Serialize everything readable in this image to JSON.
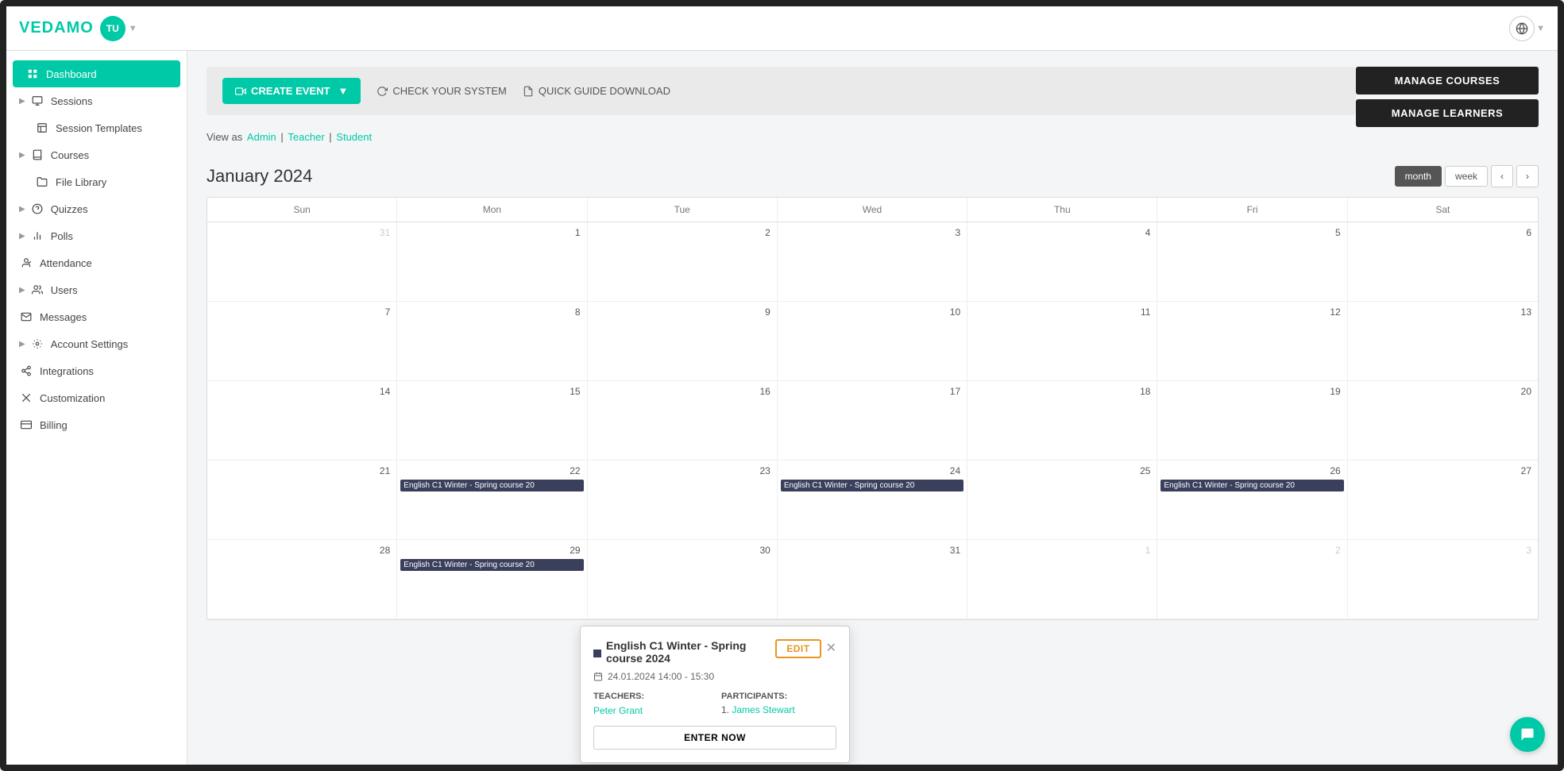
{
  "app": {
    "logo": "VEDAMO",
    "avatar": "TU",
    "title": "Dashboard"
  },
  "sidebar": {
    "items": [
      {
        "id": "dashboard",
        "label": "Dashboard",
        "icon": "grid",
        "active": true,
        "hasArrow": false
      },
      {
        "id": "sessions",
        "label": "Sessions",
        "icon": "video",
        "active": false,
        "hasArrow": true
      },
      {
        "id": "session-templates",
        "label": "Session Templates",
        "icon": "layout",
        "active": false,
        "hasArrow": false
      },
      {
        "id": "courses",
        "label": "Courses",
        "icon": "book",
        "active": false,
        "hasArrow": true
      },
      {
        "id": "file-library",
        "label": "File Library",
        "icon": "folder",
        "active": false,
        "hasArrow": false
      },
      {
        "id": "quizzes",
        "label": "Quizzes",
        "icon": "help-circle",
        "active": false,
        "hasArrow": true
      },
      {
        "id": "polls",
        "label": "Polls",
        "icon": "bar-chart",
        "active": false,
        "hasArrow": true
      },
      {
        "id": "attendance",
        "label": "Attendance",
        "icon": "user-check",
        "active": false,
        "hasArrow": false
      },
      {
        "id": "users",
        "label": "Users",
        "icon": "users",
        "active": false,
        "hasArrow": true
      },
      {
        "id": "messages",
        "label": "Messages",
        "icon": "mail",
        "active": false,
        "hasArrow": false
      },
      {
        "id": "account-settings",
        "label": "Account Settings",
        "icon": "settings",
        "active": false,
        "hasArrow": true
      },
      {
        "id": "integrations",
        "label": "Integrations",
        "icon": "link",
        "active": false,
        "hasArrow": false
      },
      {
        "id": "customization",
        "label": "Customization",
        "icon": "scissors",
        "active": false,
        "hasArrow": false
      },
      {
        "id": "billing",
        "label": "Billing",
        "icon": "credit-card",
        "active": false,
        "hasArrow": false
      }
    ]
  },
  "toolbar": {
    "create_event_label": "CREATE EVENT",
    "check_system_label": "CHECK YOUR SYSTEM",
    "quick_guide_label": "QUICK GUIDE DOWNLOAD"
  },
  "right_actions": {
    "manage_courses_label": "MANAGE COURSES",
    "manage_learners_label": "MANAGE LEARNERS"
  },
  "view_as": {
    "label": "View as",
    "admin": "Admin",
    "teacher": "Teacher",
    "student": "Student"
  },
  "calendar": {
    "title": "January 2024",
    "view_month": "month",
    "view_week": "week",
    "days": [
      "Sun",
      "Mon",
      "Tue",
      "Wed",
      "Thu",
      "Fri",
      "Sat"
    ],
    "cells": [
      {
        "num": "31",
        "other": true,
        "events": []
      },
      {
        "num": "1",
        "other": false,
        "events": []
      },
      {
        "num": "2",
        "other": false,
        "events": []
      },
      {
        "num": "3",
        "other": false,
        "events": []
      },
      {
        "num": "4",
        "other": false,
        "events": []
      },
      {
        "num": "5",
        "other": false,
        "events": []
      },
      {
        "num": "6",
        "other": false,
        "events": []
      },
      {
        "num": "7",
        "other": false,
        "events": []
      },
      {
        "num": "8",
        "other": false,
        "events": []
      },
      {
        "num": "9",
        "other": false,
        "events": []
      },
      {
        "num": "10",
        "other": false,
        "events": []
      },
      {
        "num": "11",
        "other": false,
        "events": []
      },
      {
        "num": "12",
        "other": false,
        "events": []
      },
      {
        "num": "13",
        "other": false,
        "events": []
      },
      {
        "num": "14",
        "other": false,
        "events": []
      },
      {
        "num": "15",
        "other": false,
        "events": []
      },
      {
        "num": "16",
        "other": false,
        "events": []
      },
      {
        "num": "17",
        "other": false,
        "events": []
      },
      {
        "num": "18",
        "other": false,
        "events": []
      },
      {
        "num": "19",
        "other": false,
        "events": []
      },
      {
        "num": "20",
        "other": false,
        "events": []
      },
      {
        "num": "21",
        "other": false,
        "events": []
      },
      {
        "num": "22",
        "other": false,
        "events": [
          "English C1 Winter - Spring course 20"
        ]
      },
      {
        "num": "23",
        "other": false,
        "events": []
      },
      {
        "num": "24",
        "other": false,
        "events": [
          "English C1 Winter - Spring course 20"
        ]
      },
      {
        "num": "25",
        "other": false,
        "events": []
      },
      {
        "num": "26",
        "other": false,
        "events": [
          "English C1 Winter - Spring course 20"
        ]
      },
      {
        "num": "27",
        "other": false,
        "events": []
      },
      {
        "num": "28",
        "other": false,
        "events": []
      },
      {
        "num": "29",
        "other": false,
        "events": [
          "English C1 Winter - Spring course 20"
        ]
      },
      {
        "num": "30",
        "other": false,
        "events": []
      },
      {
        "num": "31",
        "other": false,
        "events": []
      },
      {
        "num": "1",
        "other": true,
        "events": []
      },
      {
        "num": "2",
        "other": true,
        "events": []
      },
      {
        "num": "3",
        "other": true,
        "events": []
      }
    ]
  },
  "popup": {
    "title": "English C1 Winter - Spring course 2024",
    "date": "24.01.2024 14:00 - 15:30",
    "edit_label": "EDIT",
    "teachers_label": "TEACHERS:",
    "teacher_name": "Peter Grant",
    "participants_label": "Participants:",
    "participant_1": "James Stewart",
    "enter_label": "ENTER NOW"
  },
  "chat": {
    "icon": "💬"
  }
}
